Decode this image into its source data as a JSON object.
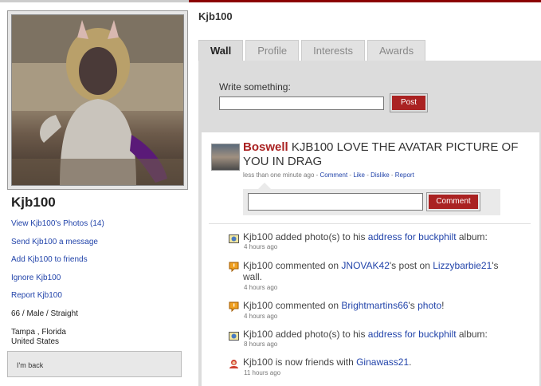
{
  "profile": {
    "username": "Kjb100",
    "links": [
      "View Kjb100's Photos (14)",
      "Send Kjb100 a message",
      "Add Kjb100 to friends",
      "Ignore Kjb100",
      "Report Kjb100"
    ],
    "info": "66 / Male / Straight",
    "location_line1": "Tampa , Florida",
    "location_line2": "United States",
    "status": "I'm back"
  },
  "page": {
    "title": "Kjb100",
    "tabs": [
      "Wall",
      "Profile",
      "Interests",
      "Awards"
    ],
    "active_tab": "Wall"
  },
  "composer": {
    "label": "Write something:",
    "input_value": "",
    "post_label": "Post"
  },
  "post": {
    "author": "Boswell",
    "text": "KJB100 LOVE THE AVATAR PICTURE OF YOU IN DRAG",
    "time": "less than one minute ago",
    "actions": [
      "Comment",
      "Like",
      "Dislike",
      "Report"
    ],
    "comment_button": "Comment",
    "comment_value": ""
  },
  "activities": [
    {
      "icon": "photo-icon",
      "user": "Kjb100",
      "text1": " added photo(s) to his ",
      "link1": "address for buckphilt",
      "text2": " album:",
      "link2": "",
      "text3": "",
      "link3": "",
      "text4": "",
      "time": "4 hours ago"
    },
    {
      "icon": "comment-icon",
      "user": "Kjb100",
      "text1": " commented on ",
      "link1": "JNOVAK42",
      "text2": "'s post on ",
      "link2": "Lizzybarbie21",
      "text3": "'s wall.",
      "link3": "",
      "text4": "",
      "time": "4 hours ago"
    },
    {
      "icon": "comment-icon",
      "user": "Kjb100",
      "text1": " commented on ",
      "link1": "Brightmartins66",
      "text2": "'s ",
      "link2": "photo",
      "text3": "!",
      "link3": "",
      "text4": "",
      "time": "4 hours ago"
    },
    {
      "icon": "photo-icon",
      "user": "Kjb100",
      "text1": " added photo(s) to his ",
      "link1": "address for buckphilt",
      "text2": " album:",
      "link2": "",
      "text3": "",
      "link3": "",
      "text4": "",
      "time": "8 hours ago"
    },
    {
      "icon": "friend-icon",
      "user": "Kjb100",
      "text1": " is now friends with ",
      "link1": "Ginawass21",
      "text2": ".",
      "link2": "",
      "text3": "",
      "link3": "",
      "text4": "",
      "time": "11 hours ago"
    }
  ],
  "colors": {
    "accent": "#aa2222",
    "link": "#2244aa",
    "panel": "#dcdcdc",
    "topbar": "#8b0000"
  }
}
